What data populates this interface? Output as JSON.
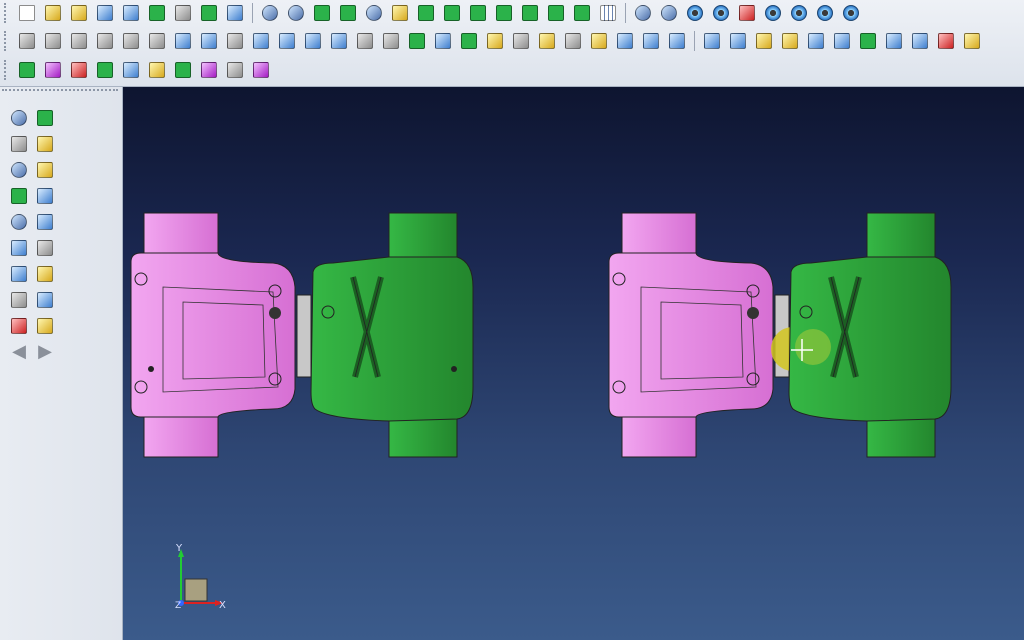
{
  "toolbar": {
    "row1": [
      {
        "name": "new-icon",
        "style": "doc"
      },
      {
        "name": "open-icon",
        "style": "yellow"
      },
      {
        "name": "open-recent-icon",
        "style": "yellow"
      },
      {
        "name": "save-icon",
        "style": "blue"
      },
      {
        "name": "save-as-icon",
        "style": "blue"
      },
      {
        "name": "import-icon",
        "style": "green"
      },
      {
        "name": "print-icon",
        "style": "cube"
      },
      {
        "name": "preview-icon",
        "style": "green"
      },
      {
        "name": "window-icon",
        "style": "blue"
      },
      {
        "sep": true
      },
      {
        "name": "zoom-window-icon",
        "style": "tool"
      },
      {
        "name": "zoom-fit-icon",
        "style": "tool"
      },
      {
        "name": "pan-icon",
        "style": "green"
      },
      {
        "name": "rotate-icon",
        "style": "green"
      },
      {
        "name": "axis-icon",
        "style": "tool"
      },
      {
        "name": "view-mode-icon",
        "style": "yellow"
      },
      {
        "name": "view-front-icon",
        "style": "green"
      },
      {
        "name": "view-back-icon",
        "style": "green"
      },
      {
        "name": "view-left-icon",
        "style": "green"
      },
      {
        "name": "view-right-icon",
        "style": "green"
      },
      {
        "name": "view-top-icon",
        "style": "green"
      },
      {
        "name": "view-bottom-icon",
        "style": "green"
      },
      {
        "name": "view-iso-icon",
        "style": "green"
      },
      {
        "name": "scale-1-1-icon",
        "style": "grid"
      },
      {
        "sep": true
      },
      {
        "name": "filter-icon",
        "style": "tool"
      },
      {
        "name": "inspect-icon",
        "style": "tool"
      },
      {
        "name": "layer-1-icon",
        "style": "eye"
      },
      {
        "name": "layer-2-icon",
        "style": "eye"
      },
      {
        "name": "traffic-light-icon",
        "style": "red"
      },
      {
        "name": "layer-3-icon",
        "style": "eye"
      },
      {
        "name": "layer-4-icon",
        "style": "eye"
      },
      {
        "name": "layer-add-icon",
        "style": "eye"
      },
      {
        "name": "layer-remove-icon",
        "style": "eye"
      }
    ],
    "row2": [
      {
        "name": "box-icon",
        "style": "cube"
      },
      {
        "name": "cylinder-icon",
        "style": "cube"
      },
      {
        "name": "prism-icon",
        "style": "cube"
      },
      {
        "name": "cone-icon",
        "style": "cube"
      },
      {
        "name": "sphere-icon",
        "style": "cube"
      },
      {
        "name": "torus-icon",
        "style": "cube"
      },
      {
        "name": "boolean-union-icon",
        "style": "blue"
      },
      {
        "name": "boolean-subtract-icon",
        "style": "blue"
      },
      {
        "name": "boolean-intersect-icon",
        "style": "cube"
      },
      {
        "name": "solid-blue-icon",
        "style": "blue"
      },
      {
        "name": "solid-shell-icon",
        "style": "blue"
      },
      {
        "name": "sweep-icon",
        "style": "blue"
      },
      {
        "name": "loft-icon",
        "style": "blue"
      },
      {
        "name": "extrude-icon",
        "style": "cube"
      },
      {
        "name": "revolve-icon",
        "style": "cube"
      },
      {
        "name": "move-icon",
        "style": "green"
      },
      {
        "name": "offset-icon",
        "style": "blue"
      },
      {
        "name": "surface-icon",
        "style": "green"
      },
      {
        "name": "block-icon",
        "style": "yellow"
      },
      {
        "name": "chamfer-icon",
        "style": "cube"
      },
      {
        "name": "fillet-icon",
        "style": "yellow"
      },
      {
        "name": "draft-icon",
        "style": "cube"
      },
      {
        "name": "split-icon",
        "style": "yellow"
      },
      {
        "name": "pattern-icon",
        "style": "blue"
      },
      {
        "name": "mirror-icon",
        "style": "blue"
      },
      {
        "name": "trim-icon",
        "style": "blue"
      },
      {
        "sep": true
      },
      {
        "name": "solid-a-icon",
        "style": "blue"
      },
      {
        "name": "solid-b-icon",
        "style": "blue"
      },
      {
        "name": "solid-c-icon",
        "style": "yellow"
      },
      {
        "name": "solid-d-icon",
        "style": "yellow"
      },
      {
        "name": "solid-e-icon",
        "style": "blue"
      },
      {
        "name": "solid-f-icon",
        "style": "blue"
      },
      {
        "name": "solid-g-icon",
        "style": "green"
      },
      {
        "name": "solid-h-icon",
        "style": "blue"
      },
      {
        "name": "solid-i-icon",
        "style": "blue"
      },
      {
        "name": "delete-solid-icon",
        "style": "red"
      },
      {
        "name": "solid-j-icon",
        "style": "yellow"
      }
    ],
    "row3": [
      {
        "name": "stack-icon",
        "style": "green"
      },
      {
        "name": "shaded-icon",
        "style": "purple"
      },
      {
        "name": "hatch-icon",
        "style": "red"
      },
      {
        "name": "measure-icon",
        "style": "green"
      },
      {
        "name": "image-icon",
        "style": "blue"
      },
      {
        "name": "ruler-icon",
        "style": "yellow"
      },
      {
        "name": "analysis-icon",
        "style": "green"
      },
      {
        "name": "arch-icon",
        "style": "purple"
      },
      {
        "name": "printer-3d-icon",
        "style": "cube"
      },
      {
        "name": "part-view-icon",
        "style": "purple"
      }
    ]
  },
  "left_panel": {
    "buttons": [
      {
        "name": "select-icon",
        "style": "tool"
      },
      {
        "name": "point-icon",
        "style": "green"
      },
      {
        "name": "frame-icon",
        "style": "cube"
      },
      {
        "name": "corner-icon",
        "style": "yellow"
      },
      {
        "name": "zoom-select-icon",
        "style": "tool"
      },
      {
        "name": "sheet-icon",
        "style": "yellow"
      },
      {
        "name": "edge-icon",
        "style": "green"
      },
      {
        "name": "curve-icon",
        "style": "blue"
      },
      {
        "name": "wire-icon",
        "style": "tool"
      },
      {
        "name": "plane-icon",
        "style": "blue"
      },
      {
        "name": "refresh-icon",
        "style": "blue"
      },
      {
        "name": "cube-icon",
        "style": "cube"
      },
      {
        "name": "help-icon",
        "style": "blue"
      },
      {
        "name": "dimension-icon",
        "style": "yellow"
      },
      {
        "name": "delete-icon",
        "style": "cube"
      },
      {
        "name": "undo-icon",
        "style": "blue"
      },
      {
        "name": "component-icon",
        "style": "red"
      },
      {
        "name": "folder-icon",
        "style": "yellow"
      }
    ],
    "back_arrow": "◀",
    "forward_arrow": "▶"
  },
  "viewport": {
    "axis_x": "X",
    "axis_y": "Y",
    "axis_z": "Z",
    "colors": {
      "pink": "#e98ae6",
      "green": "#2ea83a",
      "plate": "#c8c8c8",
      "highlight": "#d2c51f"
    }
  }
}
